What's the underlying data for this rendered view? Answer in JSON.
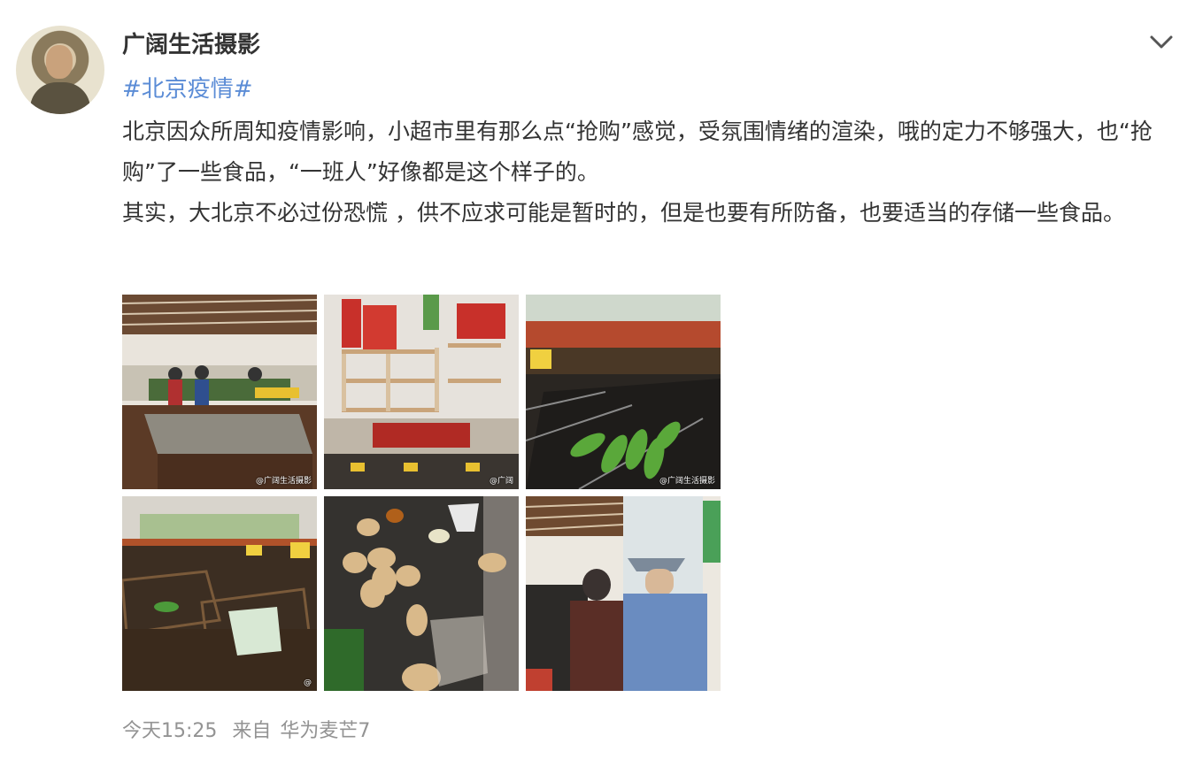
{
  "post": {
    "author": "广阔生活摄影",
    "hashtag": "#北京疫情#",
    "paragraphs": [
      "北京因众所周知疫情影响，小超市里有那么点“抢购”感觉，受氛围情绪的渲染，哦的定力不够强大，也“抢购”了一些食品，“一班人”好像都是这个样子的。",
      "其实，大北京不必过份恐慌 ，供不应求可能是暂时的，但是也要有所防备，也要适当的存储一些食品。"
    ],
    "photos": [
      {
        "watermark": "@广阔生活摄影",
        "scene": "supermarket-hall"
      },
      {
        "watermark": "@广阔",
        "scene": "empty-shelves"
      },
      {
        "watermark": "@广阔生活摄影",
        "scene": "vegetable-bins"
      },
      {
        "watermark": "@",
        "scene": "baskets"
      },
      {
        "watermark": "",
        "scene": "potatoes"
      },
      {
        "watermark": "",
        "scene": "crowd"
      }
    ],
    "meta": {
      "time": "今天15:25",
      "from_label": "来自",
      "device": "华为麦芒7"
    }
  },
  "colors": {
    "link": "#5b8cd6",
    "text": "#333333",
    "meta": "#939393"
  },
  "icons": {
    "dropdown": "chevron-down-icon"
  }
}
